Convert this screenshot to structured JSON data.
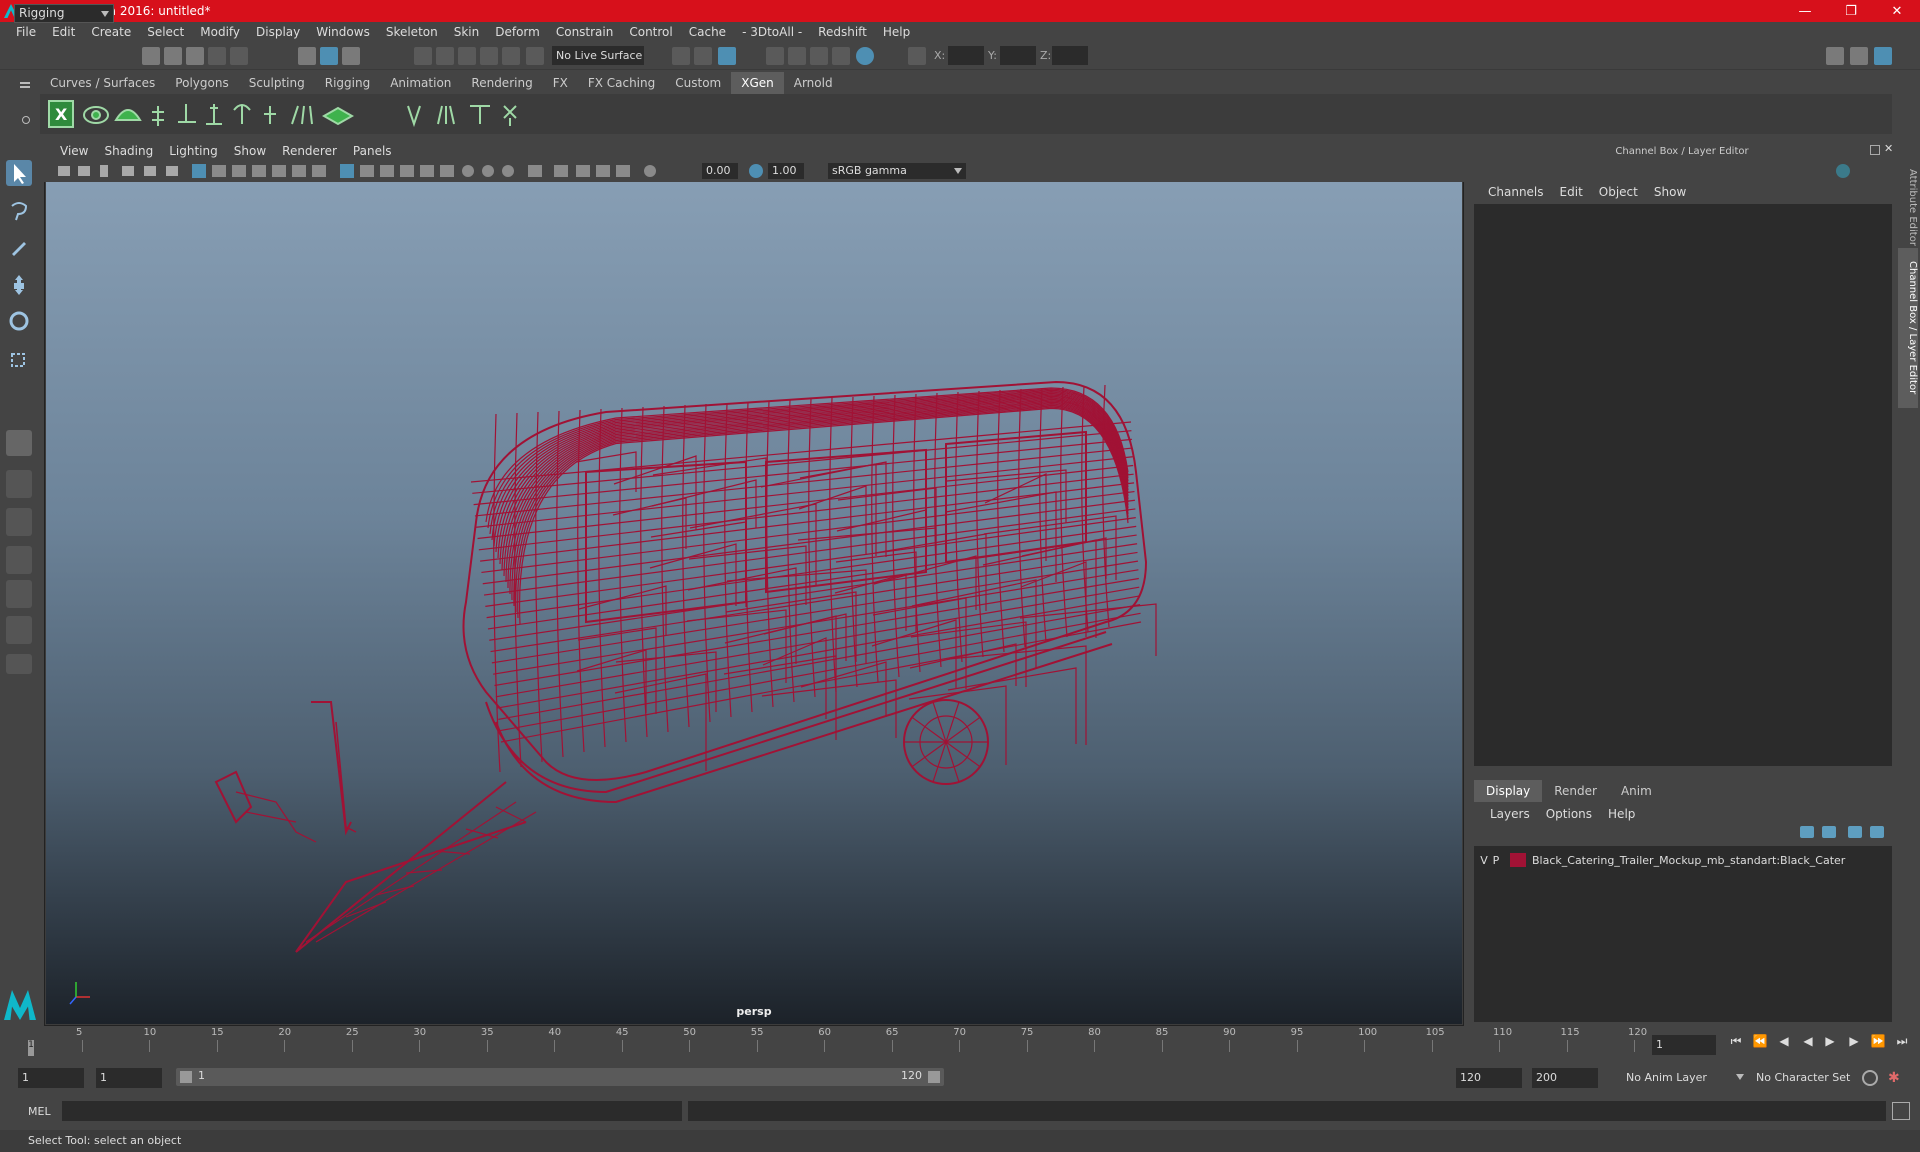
{
  "window": {
    "title": "Autodesk Maya 2016: untitled*"
  },
  "menubar": [
    "File",
    "Edit",
    "Create",
    "Select",
    "Modify",
    "Display",
    "Windows",
    "Skeleton",
    "Skin",
    "Deform",
    "Constrain",
    "Control",
    "Cache",
    "- 3DtoAll -",
    "Redshift",
    "Help"
  ],
  "statusline": {
    "mode": "Rigging",
    "live_surface": "No Live Surface",
    "x_label": "X:",
    "y_label": "Y:",
    "z_label": "Z:"
  },
  "shelf": {
    "tabs": [
      "Curves / Surfaces",
      "Polygons",
      "Sculpting",
      "Rigging",
      "Animation",
      "Rendering",
      "FX",
      "FX Caching",
      "Custom",
      "XGen",
      "Arnold"
    ],
    "active_tab": "XGen"
  },
  "viewport": {
    "menu": [
      "View",
      "Shading",
      "Lighting",
      "Show",
      "Renderer",
      "Panels"
    ],
    "exposure": "0.00",
    "gamma": "1.00",
    "color_space": "sRGB gamma",
    "camera": "persp",
    "wire_color": "#a11235"
  },
  "channel_box": {
    "header": "Channel Box / Layer Editor",
    "menu": [
      "Channels",
      "Edit",
      "Object",
      "Show"
    ]
  },
  "layer_editor": {
    "tabs": [
      "Display",
      "Render",
      "Anim"
    ],
    "active_tab": "Display",
    "menu": [
      "Layers",
      "Options",
      "Help"
    ],
    "layers": [
      {
        "v": "V",
        "p": "P",
        "name": "Black_Catering_Trailer_Mockup_mb_standart:Black_Cater",
        "color": "#a11235"
      }
    ]
  },
  "side_tabs": [
    "Attribute Editor",
    "Channel Box / Layer Editor"
  ],
  "timeline": {
    "ticks": [
      "5",
      "10",
      "15",
      "20",
      "25",
      "30",
      "35",
      "40",
      "45",
      "50",
      "55",
      "60",
      "65",
      "70",
      "75",
      "80",
      "85",
      "90",
      "95",
      "100",
      "105",
      "110",
      "115",
      "120"
    ],
    "current_frame_label": "1",
    "current_frame": "1"
  },
  "range": {
    "start": "1",
    "playback_start": "1",
    "range_start": "1",
    "range_end": "120",
    "playback_end": "120",
    "end": "200",
    "anim_layer": "No Anim Layer",
    "character_set": "No Character Set"
  },
  "command_line": {
    "label": "MEL"
  },
  "help_line": {
    "text": "Select Tool: select an object"
  }
}
